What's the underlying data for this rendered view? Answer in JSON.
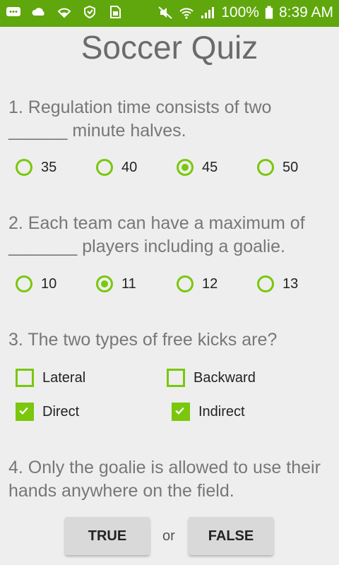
{
  "status_bar": {
    "battery": "100%",
    "time": "8:39 AM",
    "left_icons": [
      "messages-icon",
      "cloud-icon",
      "wifi-shield-icon",
      "shield-icon",
      "sim-card-icon"
    ],
    "right_icons": [
      "mute-icon",
      "wifi-icon",
      "signal-icon",
      "battery-icon"
    ]
  },
  "title": "Soccer Quiz",
  "questions": [
    {
      "text": "1. Regulation time consists of two ______ minute halves.",
      "options": [
        "35",
        "40",
        "45",
        "50"
      ],
      "selected": "45"
    },
    {
      "text": "2. Each team can have a maximum of _______ players including a goalie.",
      "options": [
        "10",
        "11",
        "12",
        "13"
      ],
      "selected": "11"
    },
    {
      "text": "3. The two types of free kicks are?",
      "options": [
        {
          "label": "Lateral",
          "checked": false
        },
        {
          "label": "Backward",
          "checked": false
        },
        {
          "label": "Direct",
          "checked": true
        },
        {
          "label": "Indirect",
          "checked": true
        }
      ]
    },
    {
      "text": "4. Only the goalie is allowed to use their hands anywhere on the field.",
      "true_label": "TRUE",
      "or_label": "or",
      "false_label": "FALSE"
    }
  ],
  "colors": {
    "status_bar": "#5fa70c",
    "accent": "#7ac70c",
    "background": "#eeeeee"
  }
}
